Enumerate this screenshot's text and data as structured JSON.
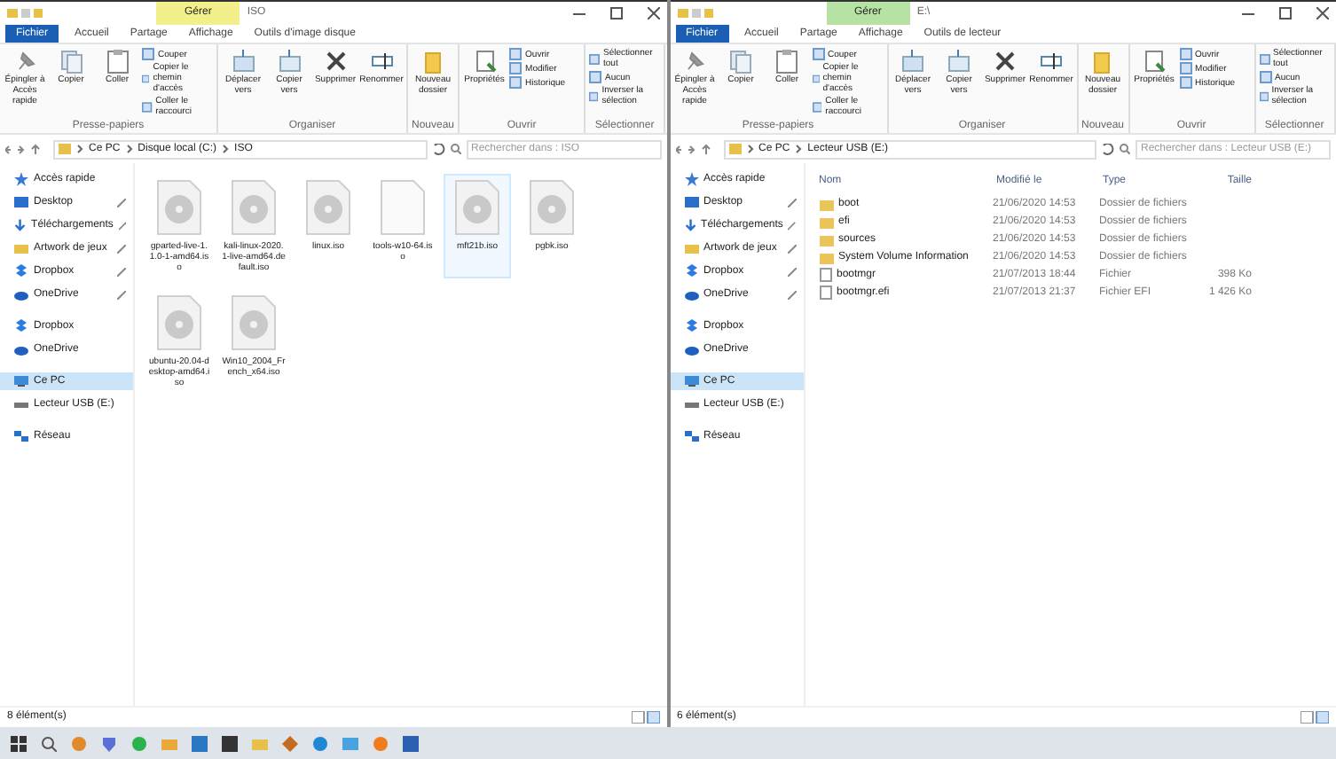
{
  "windows": [
    {
      "title": "ISO",
      "context_tab": {
        "label": "Gérer",
        "color": "#f3ef8a"
      },
      "tabs": [
        {
          "label": "Fichier",
          "selected": true
        },
        {
          "label": "Accueil",
          "selected": false
        },
        {
          "label": "Partage",
          "selected": false
        },
        {
          "label": "Affichage",
          "selected": false
        },
        {
          "label": "Outils d'image disque",
          "selected": false
        }
      ],
      "ribbon": [
        {
          "label": "Presse-papiers",
          "items": [
            {
              "label": "Épingler à Accès rapide",
              "kind": "large"
            },
            {
              "label": "Copier",
              "kind": "large"
            },
            {
              "label": "Coller",
              "kind": "large"
            },
            {
              "label": "Couper",
              "kind": "small"
            },
            {
              "label": "Copier le chemin d'accès",
              "kind": "small"
            },
            {
              "label": "Coller le raccourci",
              "kind": "small"
            }
          ]
        },
        {
          "label": "Organiser",
          "items": [
            {
              "label": "Déplacer vers",
              "kind": "large"
            },
            {
              "label": "Copier vers",
              "kind": "large"
            },
            {
              "label": "Supprimer",
              "kind": "large"
            },
            {
              "label": "Renommer",
              "kind": "large"
            }
          ]
        },
        {
          "label": "Nouveau",
          "items": [
            {
              "label": "Nouveau dossier",
              "kind": "large"
            }
          ]
        },
        {
          "label": "Ouvrir",
          "items": [
            {
              "label": "Propriétés",
              "kind": "large"
            },
            {
              "label": "Ouvrir",
              "kind": "small"
            },
            {
              "label": "Modifier",
              "kind": "small"
            },
            {
              "label": "Historique",
              "kind": "small"
            }
          ]
        },
        {
          "label": "Sélectionner",
          "items": [
            {
              "label": "Sélectionner tout",
              "kind": "small"
            },
            {
              "label": "Aucun",
              "kind": "small"
            },
            {
              "label": "Inverser la sélection",
              "kind": "small"
            }
          ]
        }
      ],
      "address": [
        "Ce PC",
        "Disque local (C:)",
        "ISO"
      ],
      "search": {
        "placeholder": "Rechercher dans : ISO"
      },
      "nav": [
        {
          "label": "Accès rapide",
          "pinned": false,
          "selected": false
        },
        {
          "label": "Desktop",
          "pinned": true,
          "selected": false
        },
        {
          "label": "Téléchargements",
          "pinned": true,
          "selected": false
        },
        {
          "label": "Artwork de jeux",
          "pinned": true,
          "selected": false
        },
        {
          "label": "Dropbox",
          "pinned": true,
          "selected": false
        },
        {
          "label": "OneDrive",
          "pinned": true,
          "selected": false
        },
        {
          "label": "Dropbox",
          "pinned": false,
          "selected": false
        },
        {
          "label": "OneDrive",
          "pinned": false,
          "selected": false
        },
        {
          "label": "Ce PC",
          "pinned": false,
          "selected": true
        },
        {
          "label": "Lecteur USB (E:)",
          "pinned": false,
          "selected": false
        },
        {
          "label": "Réseau",
          "pinned": false,
          "selected": false
        }
      ],
      "files": [
        {
          "name": "gparted-live-1.1.0-1-amd64.iso",
          "kind": "disc",
          "selected": false
        },
        {
          "name": "kali-linux-2020.1-live-amd64.default.iso",
          "kind": "disc",
          "selected": false
        },
        {
          "name": "linux.iso",
          "kind": "disc",
          "selected": false
        },
        {
          "name": "tools-w10-64.iso",
          "kind": "blank",
          "selected": false
        },
        {
          "name": "mft21b.iso",
          "kind": "disc",
          "selected": true
        },
        {
          "name": "pgbk.iso",
          "kind": "disc",
          "selected": false
        },
        {
          "name": "ubuntu-20.04-desktop-amd64.iso",
          "kind": "disc",
          "selected": false
        },
        {
          "name": "Win10_2004_French_x64.iso",
          "kind": "disc",
          "selected": false
        }
      ],
      "status": "8 élément(s)"
    },
    {
      "title": "E:\\",
      "context_tab": {
        "label": "Gérer",
        "color": "#b6e3a3"
      },
      "tabs": [
        {
          "label": "Fichier",
          "selected": true
        },
        {
          "label": "Accueil",
          "selected": false
        },
        {
          "label": "Partage",
          "selected": false
        },
        {
          "label": "Affichage",
          "selected": false
        },
        {
          "label": "Outils de lecteur",
          "selected": false
        }
      ],
      "ribbon": [
        {
          "label": "Presse-papiers",
          "items": [
            {
              "label": "Épingler à Accès rapide",
              "kind": "large"
            },
            {
              "label": "Copier",
              "kind": "large"
            },
            {
              "label": "Coller",
              "kind": "large"
            },
            {
              "label": "Couper",
              "kind": "small"
            },
            {
              "label": "Copier le chemin d'accès",
              "kind": "small"
            },
            {
              "label": "Coller le raccourci",
              "kind": "small"
            }
          ]
        },
        {
          "label": "Organiser",
          "items": [
            {
              "label": "Déplacer vers",
              "kind": "large"
            },
            {
              "label": "Copier vers",
              "kind": "large"
            },
            {
              "label": "Supprimer",
              "kind": "large"
            },
            {
              "label": "Renommer",
              "kind": "large"
            }
          ]
        },
        {
          "label": "Nouveau",
          "items": [
            {
              "label": "Nouveau dossier",
              "kind": "large"
            }
          ]
        },
        {
          "label": "Ouvrir",
          "items": [
            {
              "label": "Propriétés",
              "kind": "large"
            },
            {
              "label": "Ouvrir",
              "kind": "small"
            },
            {
              "label": "Modifier",
              "kind": "small"
            },
            {
              "label": "Historique",
              "kind": "small"
            }
          ]
        },
        {
          "label": "Sélectionner",
          "items": [
            {
              "label": "Sélectionner tout",
              "kind": "small"
            },
            {
              "label": "Aucun",
              "kind": "small"
            },
            {
              "label": "Inverser la sélection",
              "kind": "small"
            }
          ]
        }
      ],
      "address": [
        "Ce PC",
        "Lecteur USB (E:)"
      ],
      "search": {
        "placeholder": "Rechercher dans : Lecteur USB (E:)"
      },
      "nav": [
        {
          "label": "Accès rapide",
          "pinned": false,
          "selected": false
        },
        {
          "label": "Desktop",
          "pinned": true,
          "selected": false
        },
        {
          "label": "Téléchargements",
          "pinned": true,
          "selected": false
        },
        {
          "label": "Artwork de jeux",
          "pinned": true,
          "selected": false
        },
        {
          "label": "Dropbox",
          "pinned": true,
          "selected": false
        },
        {
          "label": "OneDrive",
          "pinned": true,
          "selected": false
        },
        {
          "label": "Dropbox",
          "pinned": false,
          "selected": false
        },
        {
          "label": "OneDrive",
          "pinned": false,
          "selected": false
        },
        {
          "label": "Ce PC",
          "pinned": false,
          "selected": true
        },
        {
          "label": "Lecteur USB (E:)",
          "pinned": false,
          "selected": false
        },
        {
          "label": "Réseau",
          "pinned": false,
          "selected": false
        }
      ],
      "columns": [
        "Nom",
        "Modifié le",
        "Type",
        "Taille"
      ],
      "files": [
        {
          "name": "boot",
          "modified": "21/06/2020 14:53",
          "type": "Dossier de fichiers",
          "kind": "folder"
        },
        {
          "name": "efi",
          "modified": "21/06/2020 14:53",
          "type": "Dossier de fichiers",
          "kind": "folder"
        },
        {
          "name": "sources",
          "modified": "21/06/2020 14:53",
          "type": "Dossier de fichiers",
          "kind": "folder"
        },
        {
          "name": "System Volume Information",
          "modified": "21/06/2020 14:53",
          "type": "Dossier de fichiers",
          "kind": "folder"
        },
        {
          "name": "bootmgr",
          "modified": "21/07/2013 18:44",
          "type": "Fichier",
          "size": "398 Ko",
          "kind": "file"
        },
        {
          "name": "bootmgr.efi",
          "modified": "21/07/2013 21:37",
          "type": "Fichier EFI",
          "size": "1 426 Ko",
          "kind": "file"
        }
      ],
      "status": "6 élément(s)"
    }
  ]
}
